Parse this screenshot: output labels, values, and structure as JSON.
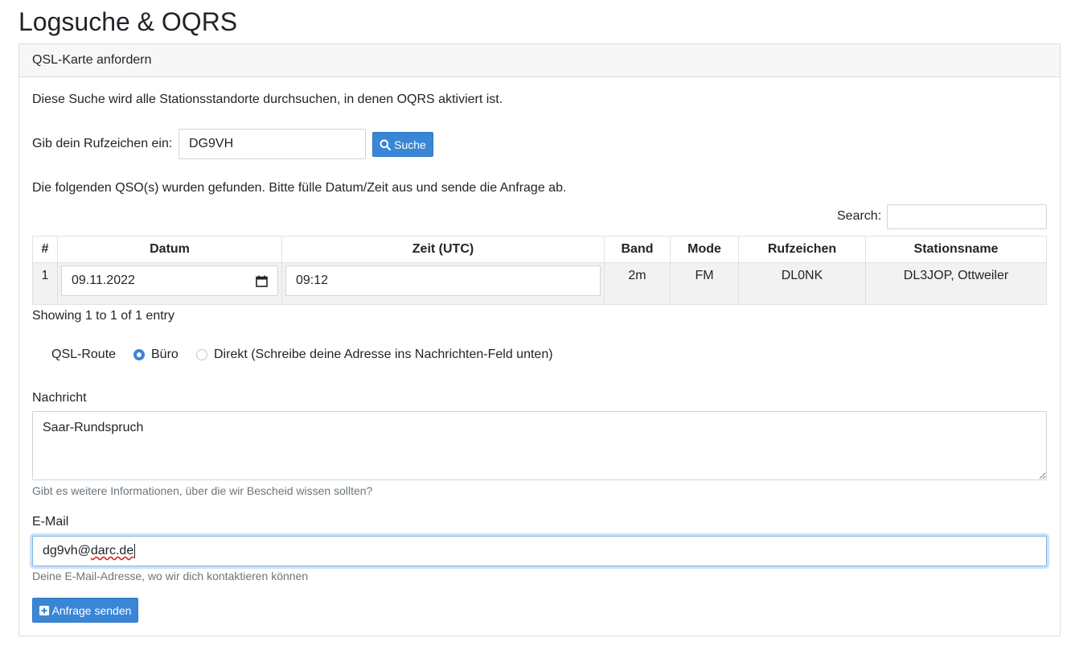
{
  "page": {
    "title": "Logsuche & OQRS"
  },
  "card": {
    "header": "QSL-Karte anfordern",
    "intro": "Diese Suche wird alle Stationsstandorte durchsuchen, in denen OQRS aktiviert ist."
  },
  "callsign_search": {
    "label": "Gib dein Rufzeichen ein:",
    "value": "DG9VH",
    "button_label": "Suche",
    "button_icon": "search-icon"
  },
  "results": {
    "info": "Die folgenden QSO(s) wurden gefunden. Bitte fülle Datum/Zeit aus und sende die Anfrage ab.",
    "search_label": "Search:",
    "search_value": "",
    "columns": [
      "#",
      "Datum",
      "Zeit (UTC)",
      "Band",
      "Mode",
      "Rufzeichen",
      "Stationsname"
    ],
    "rows": [
      {
        "num": "1",
        "date": "09.11.2022",
        "time": "09:12",
        "band": "2m",
        "mode": "FM",
        "callsign": "DL0NK",
        "station": "DL3JOP, Ottweiler"
      }
    ],
    "footer": "Showing 1 to 1 of 1 entry"
  },
  "qsl_route": {
    "label": "QSL-Route",
    "options": [
      {
        "label": "Büro",
        "checked": true
      },
      {
        "label": "Direkt (Schreibe deine Adresse ins Nachrichten-Feld unten)",
        "checked": false
      }
    ]
  },
  "message": {
    "label": "Nachricht",
    "value": "Saar-Rundspruch",
    "help": "Gibt es weitere Informationen, über die wir Bescheid wissen sollten?"
  },
  "email": {
    "label": "E-Mail",
    "value_user": "dg9vh@",
    "value_domain": "darc.de",
    "help": "Deine E-Mail-Adresse, wo wir dich kontaktieren können"
  },
  "submit": {
    "label": "Anfrage senden",
    "icon": "plus-square-icon"
  },
  "colors": {
    "primary": "#3a86d6",
    "row_bg": "#f2f2f2",
    "header_bg": "#f7f7f7"
  }
}
